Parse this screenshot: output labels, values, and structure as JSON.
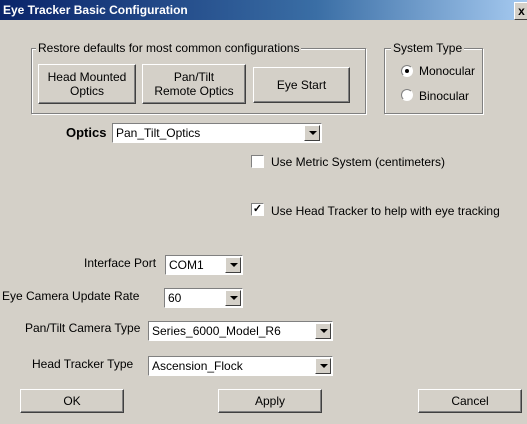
{
  "window": {
    "title": "Eye Tracker Basic Configuration",
    "close_label": "x"
  },
  "restore": {
    "legend": "Restore defaults for most common configurations",
    "head_mounted": "Head Mounted Optics",
    "pan_tilt_remote": "Pan/Tilt Remote Optics",
    "eye_start": "Eye Start"
  },
  "system_type": {
    "legend": "System Type",
    "monocular": "Monocular",
    "binocular": "Binocular",
    "selected": "Monocular"
  },
  "optics": {
    "label": "Optics",
    "value": "Pan_Tilt_Optics"
  },
  "metric": {
    "label": "Use Metric System (centimeters)",
    "checked": false
  },
  "head_tracker_help": {
    "label": "Use Head Tracker to help with eye tracking",
    "checked": true
  },
  "interface_port": {
    "label": "Interface Port",
    "value": "COM1"
  },
  "camera_rate": {
    "label": "Eye Camera Update Rate",
    "value": "60"
  },
  "pan_tilt_camera": {
    "label": "Pan/Tilt Camera Type",
    "value": "Series_6000_Model_R6"
  },
  "head_tracker_type": {
    "label": "Head Tracker Type",
    "value": "Ascension_Flock"
  },
  "footer": {
    "ok": "OK",
    "apply": "Apply",
    "cancel": "Cancel"
  }
}
